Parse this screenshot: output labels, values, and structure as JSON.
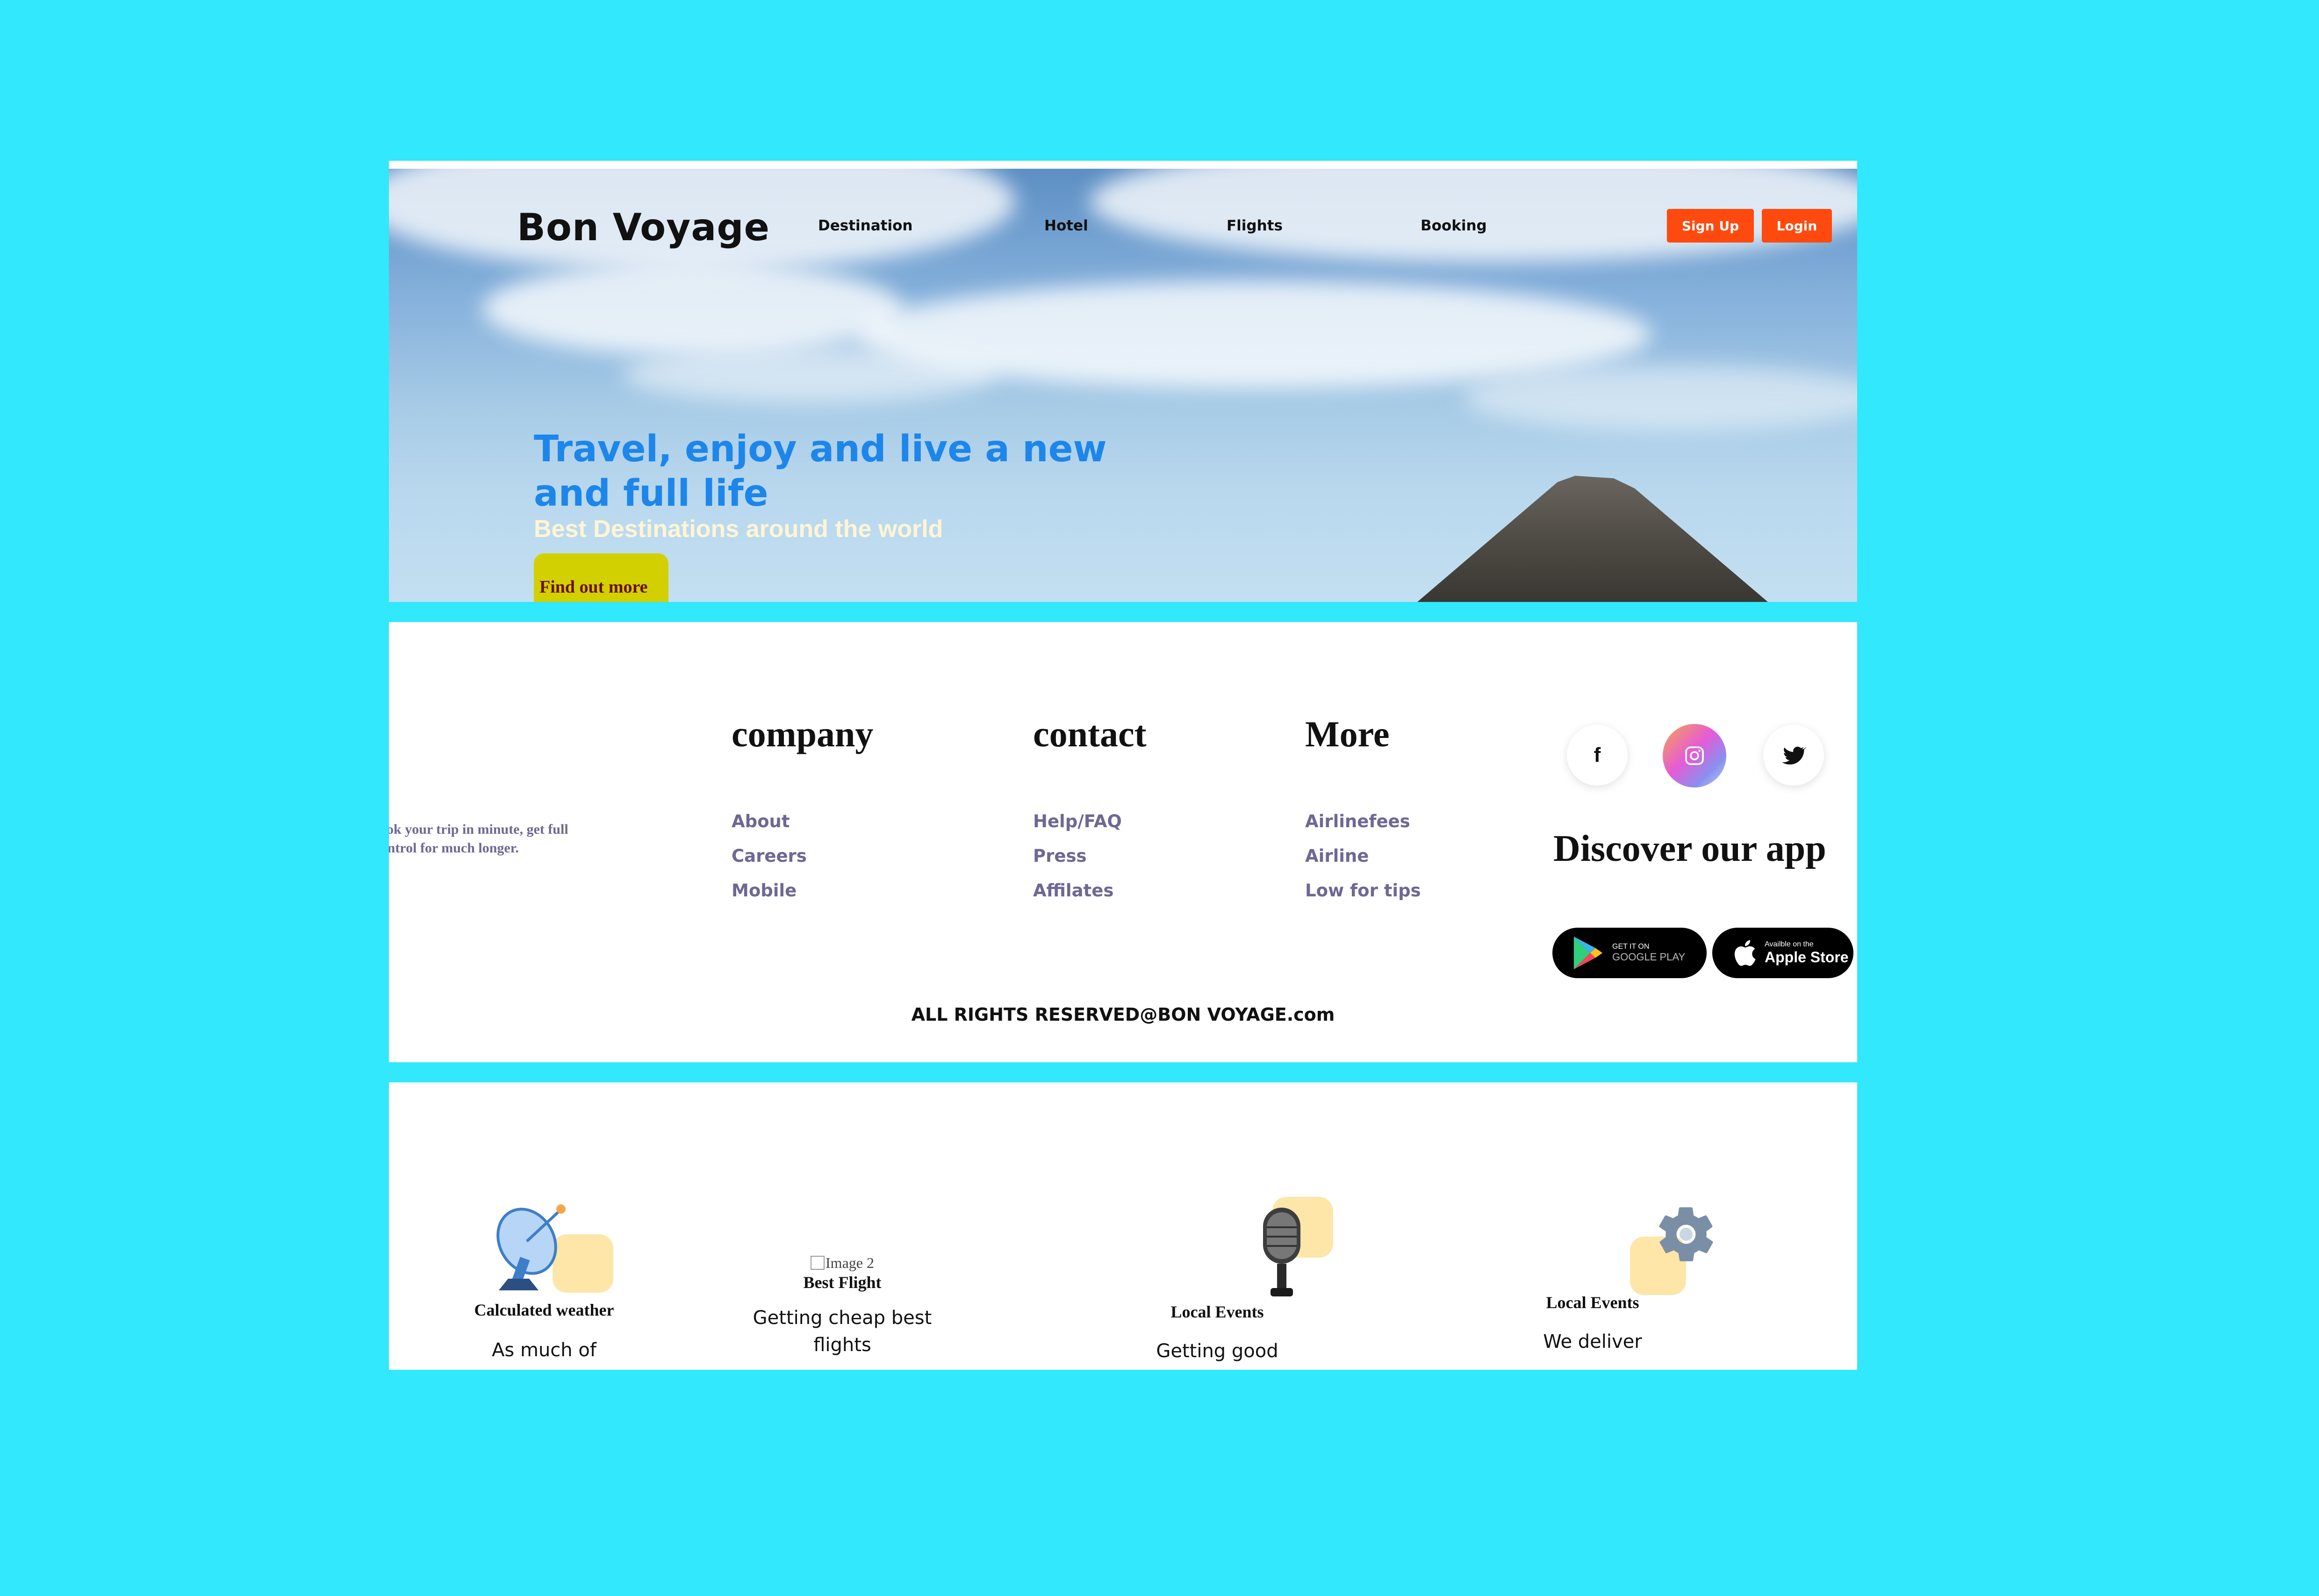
{
  "header": {
    "logo": "Bon Voyage",
    "nav": [
      "Destination",
      "Hotel",
      "Flights",
      "Booking"
    ],
    "signup_label": "Sign Up",
    "login_label": "Login"
  },
  "hero": {
    "title": "Travel, enjoy and live a new and full life",
    "subtitle": "Best Destinations around the world",
    "cta_label": "Find out more"
  },
  "footer": {
    "tagline": "Book your trip in minute, get full Control for much longer.",
    "columns": [
      {
        "title": "company",
        "links": [
          "About",
          "Careers",
          "Mobile"
        ]
      },
      {
        "title": "contact",
        "links": [
          "Help/FAQ",
          "Press",
          "Affilates"
        ]
      },
      {
        "title": "More",
        "links": [
          "Airlinefees",
          "Airline",
          "Low for tips"
        ]
      }
    ],
    "social": [
      "f",
      "",
      ""
    ],
    "discover": "Discover our app",
    "google_play": {
      "small": "GET IT ON",
      "big": "GOOGLE PLAY"
    },
    "apple_store": {
      "small": "Availble on the",
      "big": "Apple Store"
    },
    "rights": "ALL RIGHTS RESERVED@BON VOYAGE.com"
  },
  "features": [
    {
      "title": "Calculated weather",
      "desc": "As much of",
      "icon": "satellite-dish-icon"
    },
    {
      "title": "Best Flight",
      "desc": "Getting cheap best flights",
      "alt": "Image 2",
      "icon": "broken-image-icon"
    },
    {
      "title": "Local Events",
      "desc": "Getting good",
      "icon": "microphone-icon"
    },
    {
      "title": "Local Events",
      "desc": "We deliver",
      "icon": "gear-icon"
    }
  ],
  "colors": {
    "background": "#31e8fc",
    "accent_orange": "#ff4a0f",
    "hero_title": "#1d86ea",
    "cta_yellow": "#d2d000",
    "link_muted": "#6e6892"
  }
}
